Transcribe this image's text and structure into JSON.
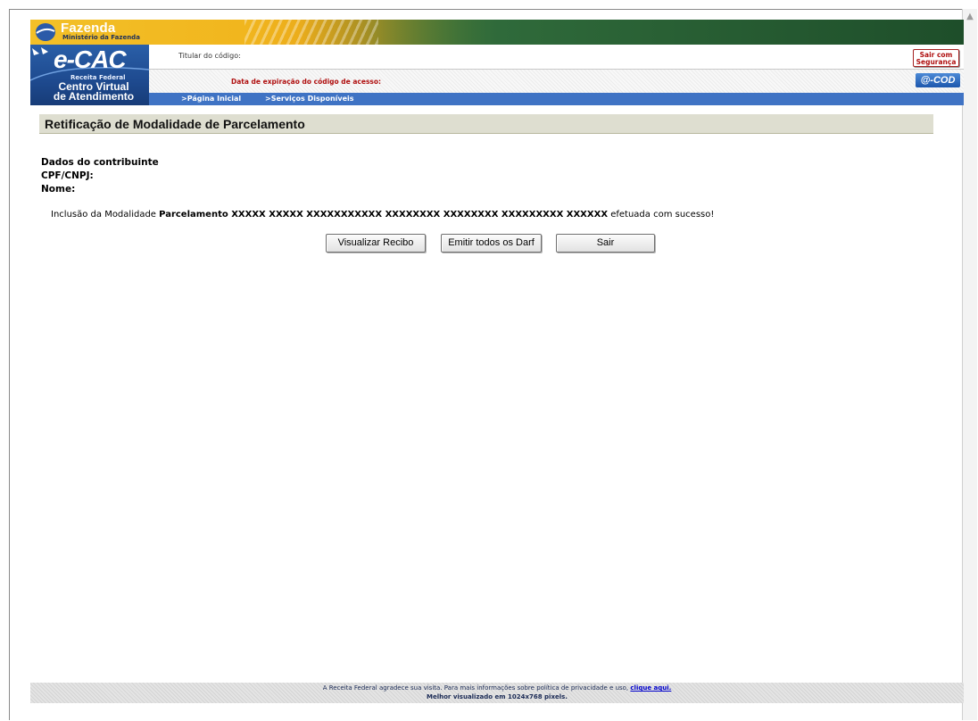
{
  "header": {
    "ministry_title": "Fazenda",
    "ministry_subtitle": "Ministério da Fazenda",
    "logo_main": "e-CAC",
    "logo_sub": "Receita Federal",
    "logo_caption_1": "Centro Virtual",
    "logo_caption_2": "de Atendimento",
    "titular_label": "Titular do código:",
    "expiration_label": "Data de expiração do código de acesso:",
    "logout_button": "Sair com Segurança",
    "ecod_button": "@-COD",
    "nav": [
      {
        "label": ">Página Inicial"
      },
      {
        "label": ">Serviços Disponíveis"
      }
    ]
  },
  "main": {
    "title": "Retificação de Modalidade de Parcelamento",
    "contributor_heading": "Dados do contribuinte",
    "cpf_label": "CPF/CNPJ:",
    "name_label": "Nome:",
    "message_prefix": "Inclusão da Modalidade",
    "message_bold": "Parcelamento XXXXX XXXXX XXXXXXXXXXX  XXXXXXXX  XXXXXXXX  XXXXXXXXX XXXXXX",
    "message_suffix": "efetuada com sucesso!",
    "buttons": {
      "receipt": "Visualizar Recibo",
      "darf": "Emitir todos os Darf",
      "exit": "Sair"
    }
  },
  "footer": {
    "line1_text": "A Receita Federal agradece sua visita. Para mais informações sobre política de privacidade e uso,",
    "line1_link": "clique aqui.",
    "line2": "Melhor visualizado em 1024x768 pixels."
  },
  "colors": {
    "nav_bar": "#3f73c4",
    "title_bar": "#deded0",
    "expiration_text": "#b01010"
  }
}
